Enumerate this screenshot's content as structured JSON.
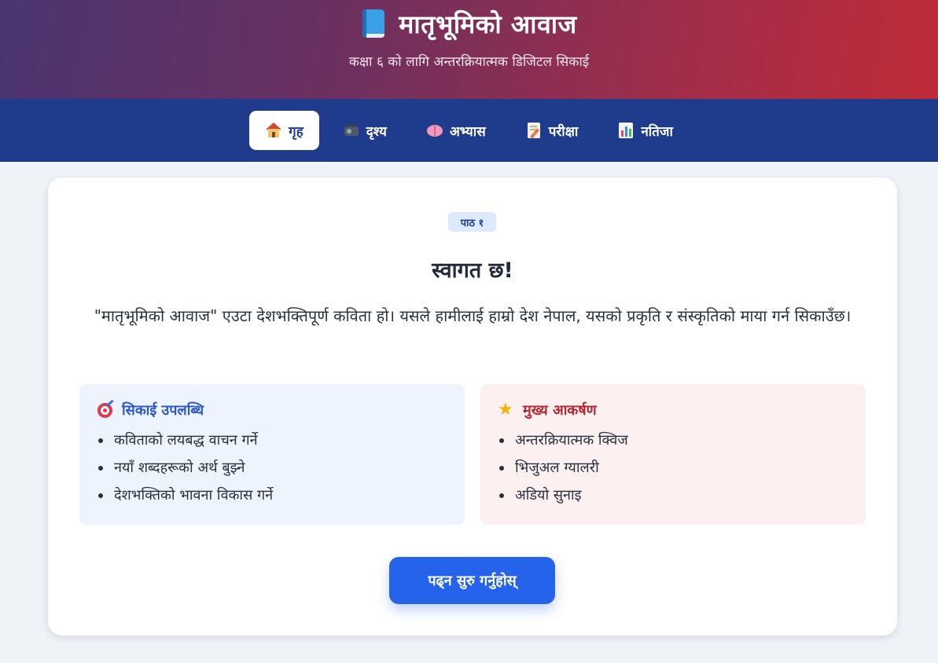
{
  "header": {
    "icon": "book-icon",
    "title": "मातृभूमिको आवाज",
    "subtitle": "कक्षा ६ को लागि अन्तरक्रियात्मक डिजिटल सिकाई"
  },
  "nav": {
    "active_tab": "home",
    "tabs": [
      {
        "id": "home",
        "icon": "house-icon",
        "label": "गृह"
      },
      {
        "id": "visual",
        "icon": "projector-icon",
        "label": "दृश्य"
      },
      {
        "id": "practice",
        "icon": "brain-icon",
        "label": "अभ्यास"
      },
      {
        "id": "exam",
        "icon": "memo-icon",
        "label": "परीक्षा"
      },
      {
        "id": "results",
        "icon": "bar-chart-icon",
        "label": "नतिजा"
      }
    ]
  },
  "main": {
    "lesson_badge": "पाठ १",
    "welcome_title": "स्वागत छ!",
    "intro_text": "\"मातृभूमिको आवाज\" एउटा देशभक्तिपूर्ण कविता हो। यसले हामीलाई हाम्रो देश नेपाल, यसको प्रकृति र संस्कृतिको माया गर्न सिकाउँछ।",
    "learning_outcomes": {
      "icon": "target-icon",
      "title": "सिकाई उपलब्धि",
      "items": [
        "कविताको लयबद्ध वाचन गर्ने",
        "नयाँ शब्दहरूको अर्थ बुझ्ने",
        "देशभक्तिको भावना विकास गर्ने"
      ]
    },
    "main_attractions": {
      "icon": "star-icon",
      "title": "मुख्य आकर्षण",
      "items": [
        "अन्तरक्रियात्मक क्विज",
        "भिजुअल ग्यालरी",
        "अडियो सुनाइ"
      ]
    },
    "start_button": "पढ्न सुरु गर्नुहोस्"
  },
  "colors": {
    "nav_background": "#1f3b8c",
    "primary_button": "#2563eb",
    "outcomes_title": "#2a56c8",
    "attractions_title": "#b8232f"
  }
}
